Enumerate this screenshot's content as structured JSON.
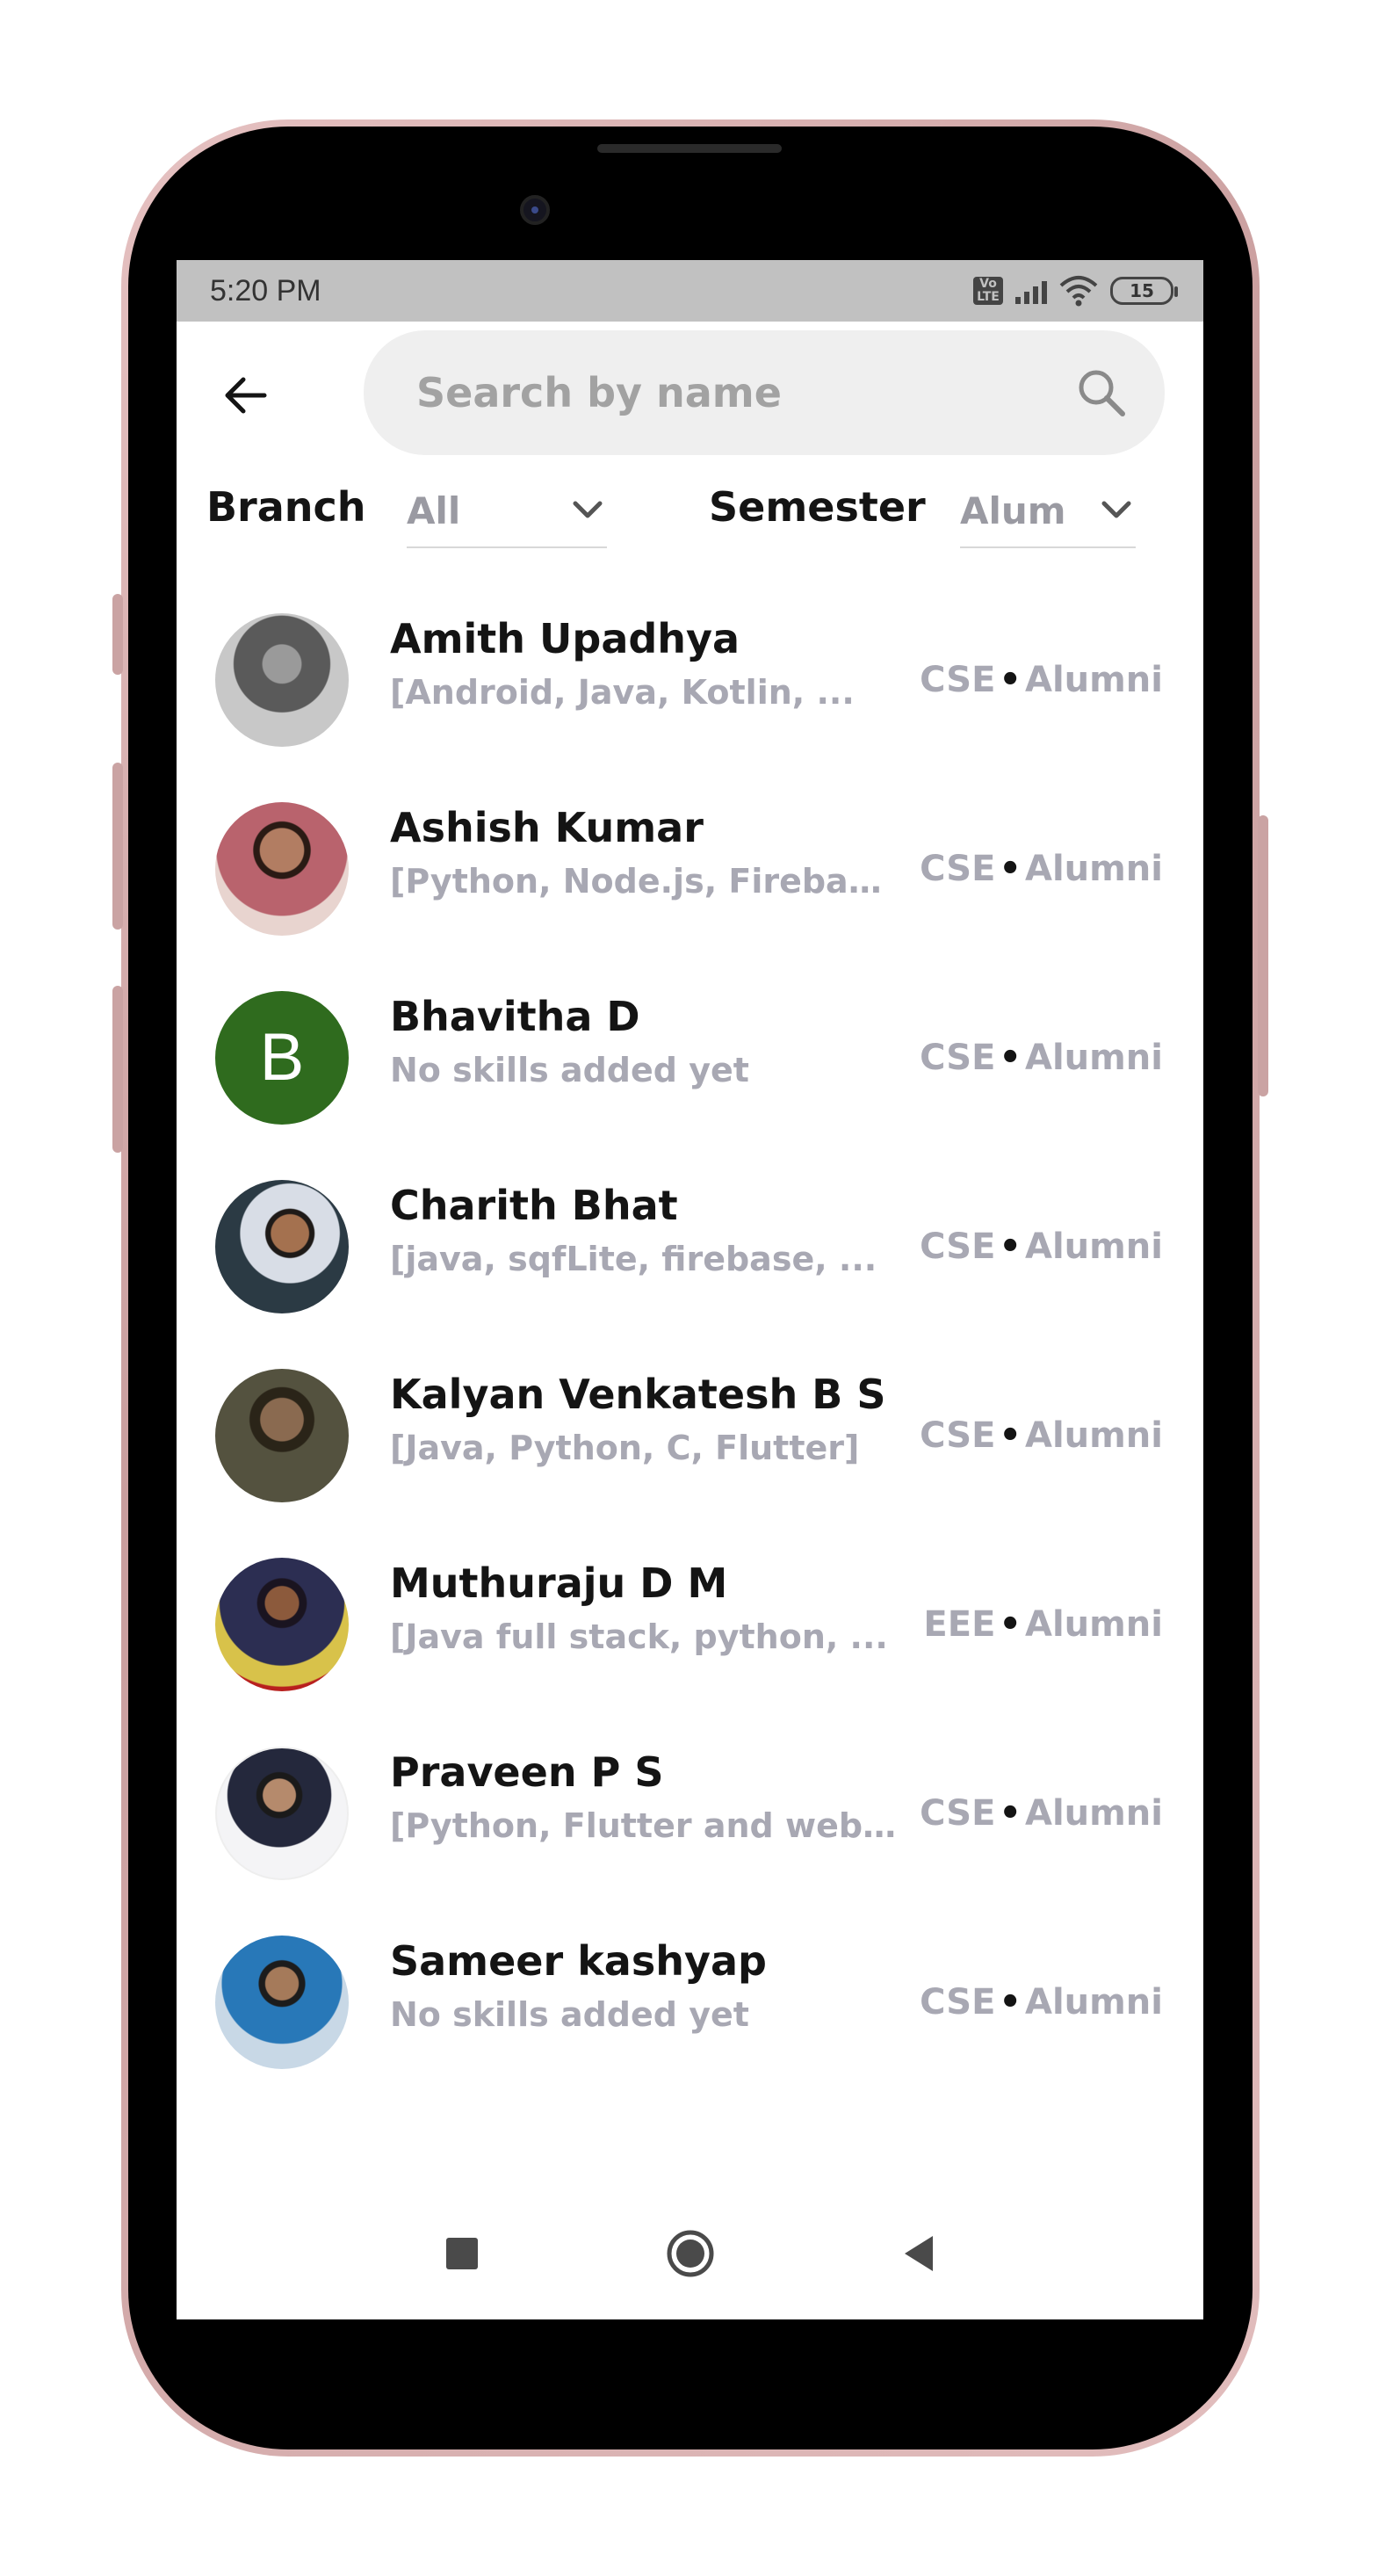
{
  "status_bar": {
    "time": "5:20 PM",
    "volte": "Vo LTE",
    "battery": "15"
  },
  "search": {
    "placeholder": "Search by name",
    "icon": "search-icon"
  },
  "back_icon": "arrow-left-icon",
  "filters": {
    "branch_label": "Branch",
    "branch_value": "All",
    "semester_label": "Semester",
    "semester_value": "Alum"
  },
  "people": [
    {
      "name": "Amith Upadhya",
      "skills": "[Android, Java, Kotlin, ...",
      "branch": "CSE",
      "status": "Alumni",
      "avatar": "photo",
      "avatar_color": "#6a6a6a"
    },
    {
      "name": "Ashish Kumar",
      "skills": "[Python, Node.js, Firebas...",
      "branch": "CSE",
      "status": "Alumni",
      "avatar": "photo",
      "avatar_color": "#b9636d"
    },
    {
      "name": "Bhavitha D",
      "skills": "No skills added yet",
      "branch": "CSE",
      "status": "Alumni",
      "avatar": "letter",
      "letter": "B",
      "avatar_color": "#2f6b1e"
    },
    {
      "name": "Charith Bhat",
      "skills": "[java, sqfLite, firebase, ...",
      "branch": "CSE",
      "status": "Alumni",
      "avatar": "photo",
      "avatar_color": "#3d4a55"
    },
    {
      "name": "Kalyan Venkatesh B S",
      "skills": "[Java, Python, C, Flutter]",
      "branch": "CSE",
      "status": "Alumni",
      "avatar": "photo",
      "avatar_color": "#4b4a3a"
    },
    {
      "name": "Muthuraju D M",
      "skills": "[Java full stack, python, ...",
      "branch": "EEE",
      "status": "Alumni",
      "avatar": "photo",
      "avatar_color": "#2c2e52"
    },
    {
      "name": "Praveen P S",
      "skills": "[Python, Flutter and web ...",
      "branch": "CSE",
      "status": "Alumni",
      "avatar": "photo",
      "avatar_color": "#d8d8dc"
    },
    {
      "name": "Sameer kashyap",
      "skills": "No skills added yet",
      "branch": "CSE",
      "status": "Alumni",
      "avatar": "photo",
      "avatar_color": "#3d7fb0"
    }
  ],
  "nav_buttons": [
    "recents-button",
    "home-button",
    "back-button"
  ]
}
